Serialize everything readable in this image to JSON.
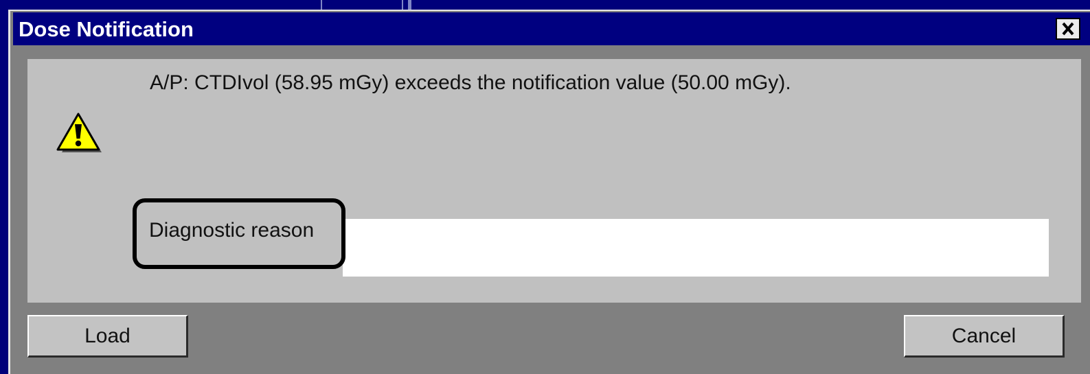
{
  "window": {
    "title": "Dose Notification",
    "close_icon": "close-icon"
  },
  "message": {
    "icon": "warning-icon",
    "text": "A/P: CTDIvol (58.95 mGy) exceeds the notification value (50.00 mGy)."
  },
  "reason": {
    "label": "Diagnostic reason",
    "value": "",
    "placeholder": ""
  },
  "buttons": {
    "load": "Load",
    "cancel": "Cancel"
  },
  "colors": {
    "title_bar": "#000080",
    "background": "#00007a",
    "dialog_body": "#808080",
    "panel": "#c0c0c0",
    "warning_fill": "#ffff00"
  }
}
